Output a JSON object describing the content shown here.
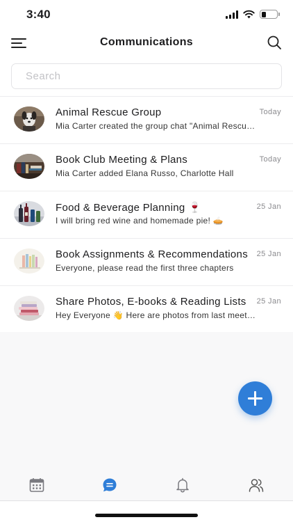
{
  "status_bar": {
    "time": "3:40"
  },
  "header": {
    "title": "Communications"
  },
  "search": {
    "placeholder": "Search"
  },
  "chats": [
    {
      "name": "Animal Rescue Group",
      "date": "Today",
      "preview": "Mia Carter created the group chat \"Animal Rescue Group\"",
      "avatar": "dog-photo"
    },
    {
      "name": "Book Club Meeting & Plans",
      "date": "Today",
      "preview": "Mia Carter added Elana Russo, Charlotte Hall",
      "avatar": "bookshelf-photo"
    },
    {
      "name": "Food & Beverage Planning 🍷",
      "date": "25 Jan",
      "preview": "I will bring red wine and homemade pie! 🥧",
      "avatar": "wine-bottles-photo"
    },
    {
      "name": "Book Assignments & Recommendations",
      "date": "25 Jan",
      "preview": "Everyone, please read the first three chapters",
      "avatar": "books-on-shelf-photo"
    },
    {
      "name": "Share Photos, E-books & Reading Lists",
      "date": "25 Jan",
      "preview": "Hey Everyone 👋 Here are photos from last meeting",
      "avatar": "book-stack-photo"
    }
  ],
  "fab": {
    "icon": "plus-icon"
  },
  "tab_bar": {
    "active": "chats",
    "items": [
      {
        "id": "calendar",
        "icon": "calendar-icon"
      },
      {
        "id": "chats",
        "icon": "chat-bubble-icon"
      },
      {
        "id": "notifications",
        "icon": "bell-icon"
      },
      {
        "id": "people",
        "icon": "people-icon"
      }
    ]
  },
  "colors": {
    "accent": "#2f7ed8",
    "text": "#1c1c1e",
    "muted": "#8a8a8e",
    "divider": "#ececee",
    "icon_gray": "#7a7a80"
  }
}
